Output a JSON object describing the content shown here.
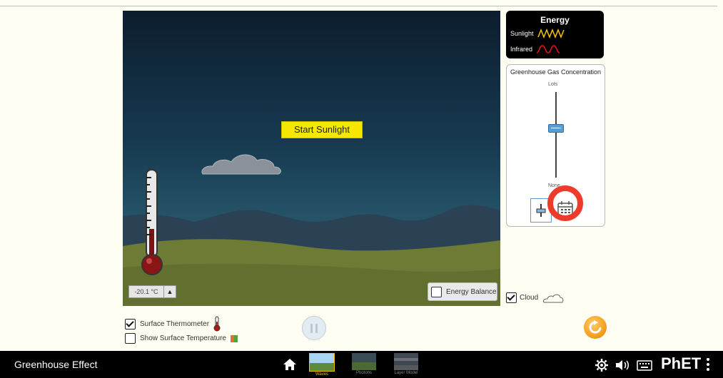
{
  "scene": {
    "start_label": "Start Sunlight",
    "temperature": "-20.1 °C",
    "temp_up": "▲",
    "energy_balance": "Energy Balance"
  },
  "energy_legend": {
    "title": "Energy",
    "sunlight": "Sunlight",
    "infrared": "Infrared",
    "sunlight_color": "#f2c500",
    "infrared_color": "#e0151b"
  },
  "concentration": {
    "title": "Greenhouse Gas Concentration",
    "lots": "Lots",
    "none": "None",
    "level": 0.58
  },
  "controls": {
    "cloud_label": "Cloud",
    "cloud_checked": true,
    "surface_thermometer": "Surface Thermometer",
    "surface_thermometer_checked": true,
    "show_surface_temp": "Show Surface Temperature",
    "show_surface_temp_checked": false
  },
  "navbar": {
    "title": "Greenhouse Effect",
    "screens": [
      {
        "label": "Waves",
        "active": true
      },
      {
        "label": "Photons",
        "active": false
      },
      {
        "label": "Layer Model",
        "active": false
      }
    ],
    "brand": "PhET"
  },
  "icons": [
    "home-icon",
    "gear-icon",
    "speaker-icon",
    "keyboard-icon",
    "kebab-menu-icon",
    "calendar-icon",
    "reset-icon",
    "pause-icon"
  ]
}
